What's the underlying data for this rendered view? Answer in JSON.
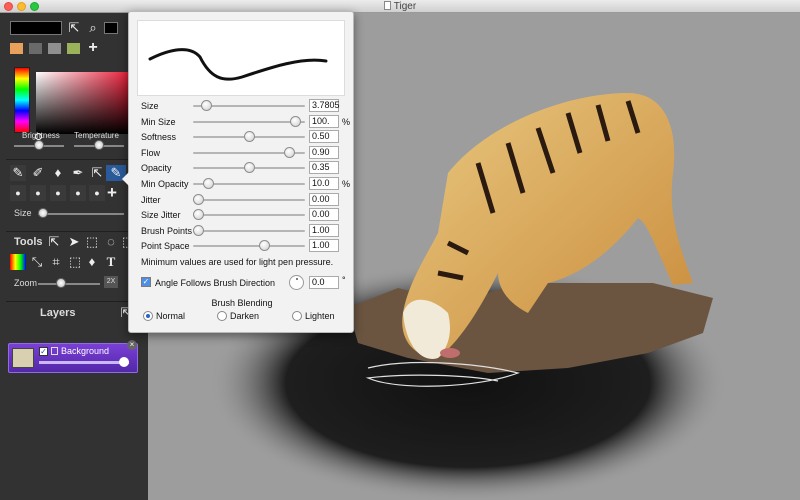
{
  "window": {
    "title": "Tiger"
  },
  "colors": {
    "current_swatch": "#000000",
    "swatches": [
      "#e8a05a",
      "#6a6a6a",
      "#8f8f8f",
      "#9ab35a",
      "#b3c87a"
    ],
    "layer_highlight": "#5a2fb3"
  },
  "color_picker": {
    "brightness_label": "Brightness",
    "temperature_label": "Temperature"
  },
  "brush_panel": {
    "size_label": "Size"
  },
  "tools": {
    "title": "Tools",
    "zoom_label": "Zoom",
    "zoom_value": "2X"
  },
  "layers": {
    "title": "Layers",
    "items": [
      {
        "name": "Background",
        "visible": true
      }
    ]
  },
  "brush_settings": {
    "params": [
      {
        "label": "Size",
        "value": "3.7805",
        "unit": "",
        "level": 0.08
      },
      {
        "label": "Min Size",
        "value": "100.",
        "unit": "%",
        "level": 0.96
      },
      {
        "label": "Softness",
        "value": "0.50",
        "unit": "",
        "level": 0.5
      },
      {
        "label": "Flow",
        "value": "0.90",
        "unit": "",
        "level": 0.9
      },
      {
        "label": "Opacity",
        "value": "0.35",
        "unit": "",
        "level": 0.5
      },
      {
        "label": "Min Opacity",
        "value": "10.0",
        "unit": "%",
        "level": 0.1
      },
      {
        "label": "Jitter",
        "value": "0.00",
        "unit": "",
        "level": 0.0
      },
      {
        "label": "Size Jitter",
        "value": "0.00",
        "unit": "",
        "level": 0.0
      },
      {
        "label": "Brush Points",
        "value": "1.00",
        "unit": "",
        "level": 0.0
      },
      {
        "label": "Point Space",
        "value": "1.00",
        "unit": "",
        "level": 0.65
      }
    ],
    "note": "Minimum values are used for light pen pressure.",
    "angle_follows_label": "Angle Follows Brush Direction",
    "angle_follows_checked": true,
    "angle_value": "0.0",
    "angle_unit": "°",
    "blending_title": "Brush Blending",
    "blending_options": [
      "Normal",
      "Darken",
      "Lighten"
    ],
    "blending_selected": "Normal"
  }
}
